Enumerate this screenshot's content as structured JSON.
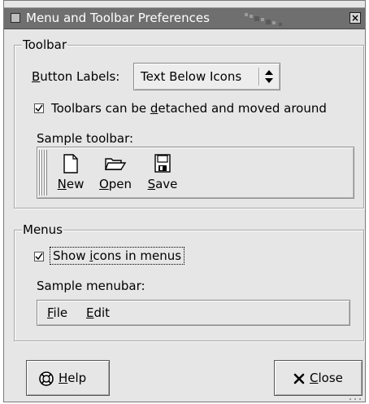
{
  "window": {
    "title": "Menu and Toolbar Preferences",
    "close_label": "×"
  },
  "toolbar_section": {
    "title": "Toolbar",
    "button_labels": {
      "label_prefix": "",
      "label_mnemonic": "B",
      "label_rest": "utton Labels:",
      "selected_value": "Text Below Icons"
    },
    "detach_checkbox": {
      "checked": true,
      "label_before": "Toolbars can be ",
      "label_mnemonic": "d",
      "label_after": "etached and moved around"
    },
    "sample_label": "Sample toolbar:",
    "sample_items": [
      {
        "icon": "new-document-icon",
        "mnemonic": "N",
        "rest": "ew"
      },
      {
        "icon": "open-folder-icon",
        "mnemonic": "O",
        "rest": "pen"
      },
      {
        "icon": "save-disk-icon",
        "mnemonic": "S",
        "rest": "ave"
      }
    ]
  },
  "menus_section": {
    "title": "Menus",
    "show_icons_checkbox": {
      "checked": true,
      "label_before": "Show ",
      "label_mnemonic": "i",
      "label_after": "cons in menus"
    },
    "sample_label": "Sample menubar:",
    "menubar_items": [
      {
        "mnemonic": "F",
        "rest": "ile"
      },
      {
        "mnemonic": "E",
        "rest": "dit"
      }
    ]
  },
  "buttons": {
    "help": {
      "mnemonic": "H",
      "rest": "elp",
      "icon": "help-lifebuoy-icon"
    },
    "close": {
      "mnemonic": "C",
      "rest": "lose",
      "icon": "close-x-icon"
    }
  }
}
